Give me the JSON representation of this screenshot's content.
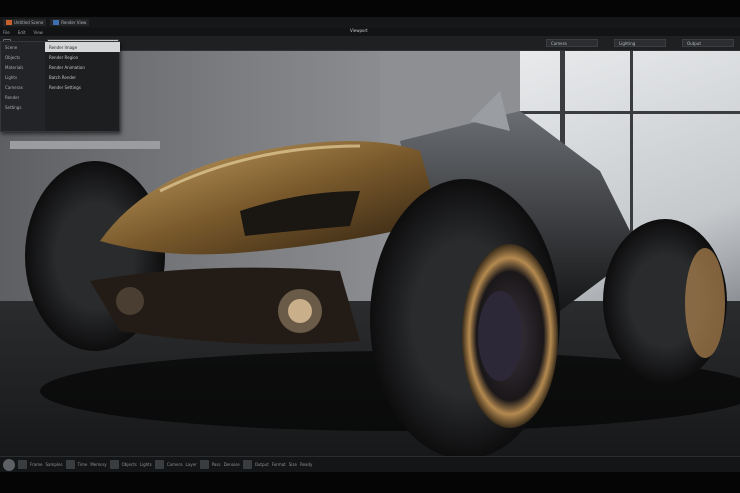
{
  "titlebar": {
    "tags": [
      "Untitled Scene",
      "Render View"
    ]
  },
  "menubar": {
    "items": [
      "File",
      "Edit",
      "View"
    ],
    "window_title": "Viewport"
  },
  "toolbar": {
    "left_label": "Render",
    "menu_field": "Render Settings",
    "fields": [
      "Camera",
      "Lighting",
      "Output"
    ]
  },
  "menu": {
    "left_items": [
      "Scene",
      "Objects",
      "Materials",
      "Lights",
      "Cameras",
      "Render",
      "Settings"
    ],
    "right_items": [
      "Render Image",
      "Render Region",
      "Render Animation",
      "Batch Render",
      "Render Settings"
    ],
    "active_index": 0
  },
  "statusbar": {
    "labels": [
      "Frame",
      "Samples",
      "Time",
      "Memory",
      "Objects",
      "Lights",
      "Camera",
      "Layer",
      "Pass",
      "Denoise",
      "Output",
      "Format",
      "Size",
      "Ready"
    ]
  },
  "colors": {
    "accent_orange": "#c8602c",
    "accent_blue": "#3d6fb1",
    "panel": "#1d1e20",
    "highlight": "#d4d6d8"
  }
}
